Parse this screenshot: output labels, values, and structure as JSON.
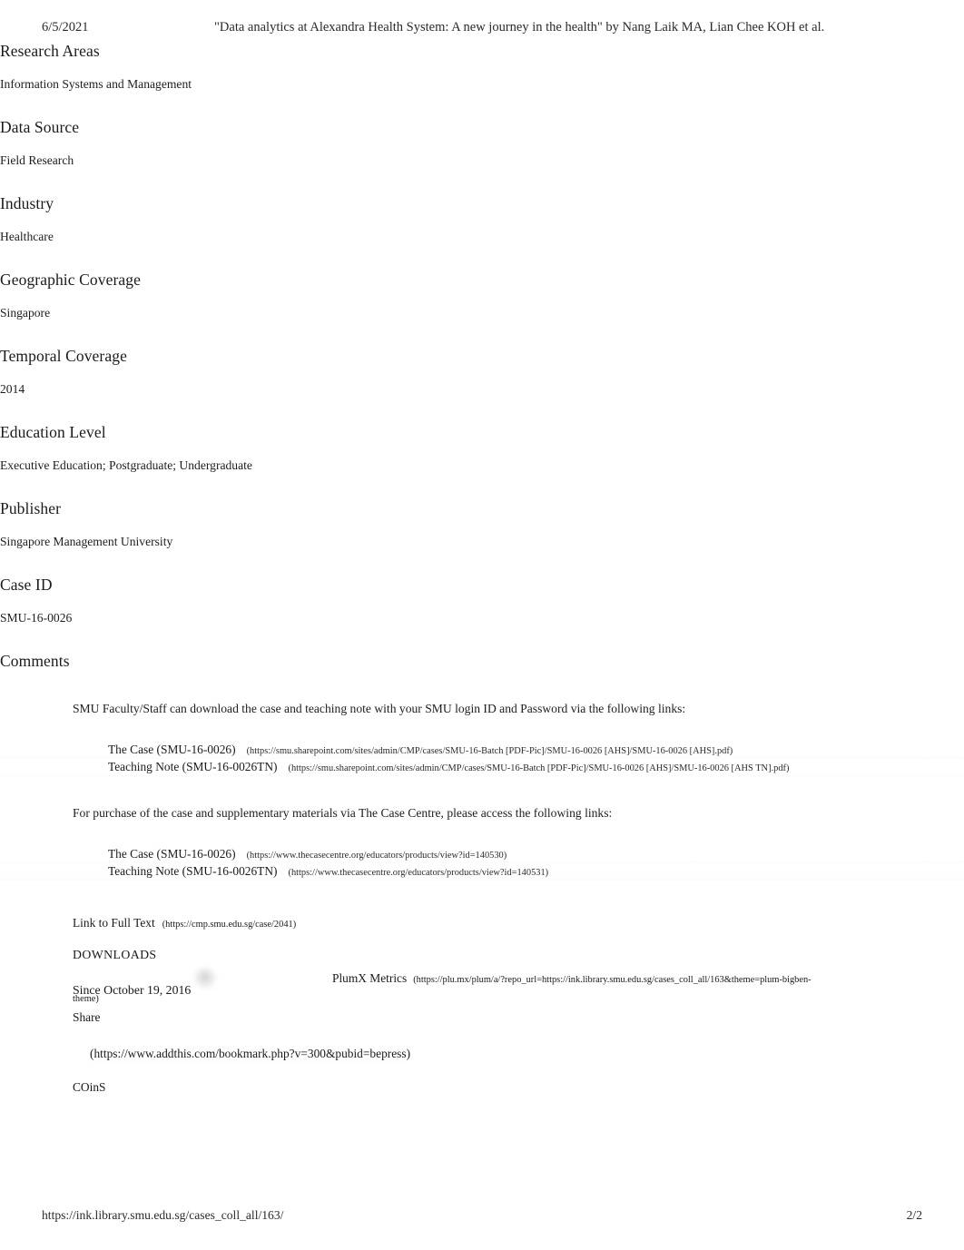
{
  "print_header": {
    "date": "6/5/2021",
    "document_title": "\"Data analytics at Alexandra Health System: A new journey in the health\" by Nang Laik MA, Lian Chee KOH et al."
  },
  "fields": [
    {
      "heading": "Research Areas",
      "value": "Information Systems and Management"
    },
    {
      "heading": "Data Source",
      "value": "Field Research"
    },
    {
      "heading": "Industry",
      "value": "Healthcare"
    },
    {
      "heading": "Geographic Coverage",
      "value": "Singapore"
    },
    {
      "heading": "Temporal Coverage",
      "value": "2014"
    },
    {
      "heading": "Education Level",
      "value": "Executive Education; Postgraduate; Undergraduate"
    },
    {
      "heading": "Publisher",
      "value": "Singapore Management University"
    },
    {
      "heading": "Case ID",
      "value": "SMU-16-0026"
    }
  ],
  "comments": {
    "heading": "Comments",
    "paragraph_1": "SMU Faculty/Staff can download the case and teaching note with your SMU login ID and Password via the following links:",
    "smu_links": [
      {
        "label": "The Case (SMU-16-0026)",
        "url": "(https://smu.sharepoint.com/sites/admin/CMP/cases/SMU-16-Batch [PDF-Pic]/SMU-16-0026 [AHS]/SMU-16-0026 [AHS].pdf)"
      },
      {
        "label": "Teaching Note (SMU-16-0026TN)",
        "url": "(https://smu.sharepoint.com/sites/admin/CMP/cases/SMU-16-Batch [PDF-Pic]/SMU-16-0026 [AHS]/SMU-16-0026 [AHS TN].pdf)"
      }
    ],
    "paragraph_2": "For purchase of the case and supplementary materials via The Case Centre, please access the following links:",
    "casecentre_links": [
      {
        "label": "The Case (SMU-16-0026)",
        "url": "(https://www.thecasecentre.org/educators/products/view?id=140530)"
      },
      {
        "label": "Teaching Note (SMU-16-0026TN)",
        "url": "(https://www.thecasecentre.org/educators/products/view?id=140531)"
      }
    ]
  },
  "full_text": {
    "label": "Link to Full Text",
    "url": "(https://cmp.smu.edu.sg/case/2041)"
  },
  "downloads": {
    "label": "DOWNLOADS",
    "since": "Since October 19, 2016"
  },
  "metrics": {
    "plumx_label": "PlumX Metrics",
    "plumx_url": "(https://plu.mx/plum/a/?repo_url=https://ink.library.smu.edu.sg/cases_coll_all/163&theme=plum-bigben-",
    "plumx_url_wrap": "theme)"
  },
  "share": {
    "label": "Share",
    "addthis_url": "(https://www.addthis.com/bookmark.php?v=300&pubid=bepress)"
  },
  "coins": {
    "label": "COinS"
  },
  "print_footer": {
    "url": "https://ink.library.smu.edu.sg/cases_coll_all/163/",
    "page": "2/2"
  }
}
